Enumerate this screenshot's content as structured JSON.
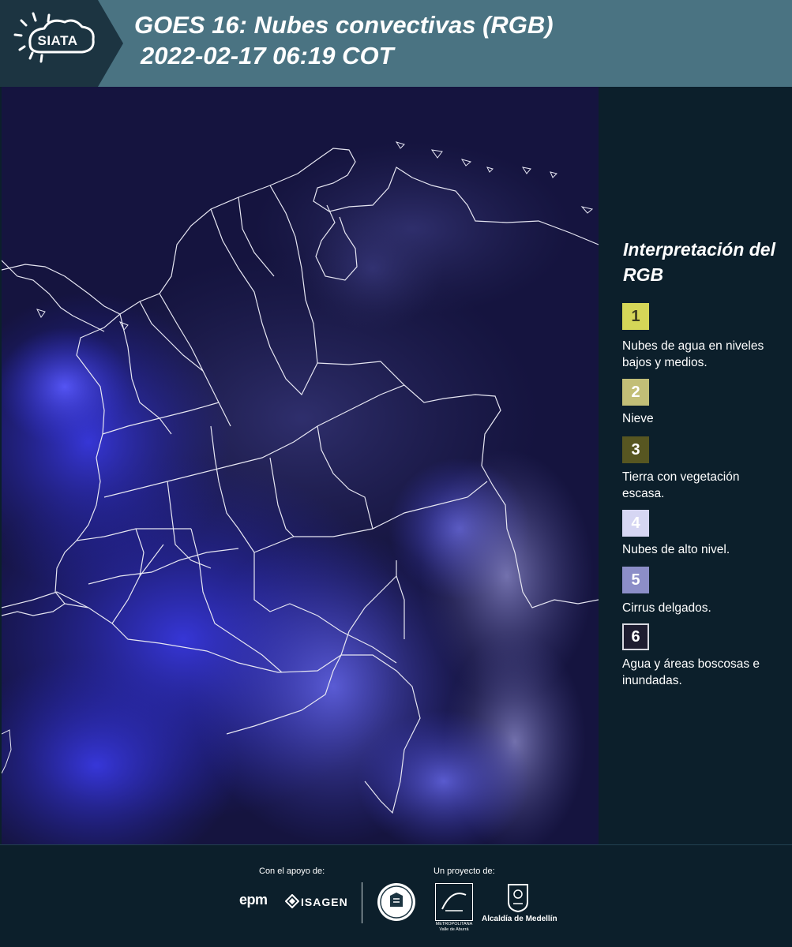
{
  "header": {
    "logo_text": "SIATA",
    "title_line1": "GOES 16: Nubes convectivas (RGB)",
    "title_line2": "2022-02-17 06:19 COT"
  },
  "legend": {
    "title": "Interpretación del RGB",
    "items": [
      {
        "number": "1",
        "label": "Nubes de agua en niveles bajos y medios.",
        "color": "#d5d658",
        "text_color": "#3d3d1f"
      },
      {
        "number": "2",
        "label": "Nieve",
        "color": "#c2be77",
        "text_color": "#ffffff"
      },
      {
        "number": "3",
        "label": "Tierra con vegetación escasa.",
        "color": "#575621",
        "text_color": "#ffffff"
      },
      {
        "number": "4",
        "label": "Nubes de alto nivel.",
        "color": "#d6d6f3",
        "text_color": "#ffffff"
      },
      {
        "number": "5",
        "label": "Cirrus delgados.",
        "color": "#8c8ec8",
        "text_color": "#ffffff"
      },
      {
        "number": "6",
        "label": "Agua y áreas boscosas e inundadas.",
        "color": "#1e1c30",
        "text_color": "#ffffff"
      }
    ]
  },
  "footer": {
    "support_caption": "Con el apoyo de:",
    "project_caption": "Un proyecto de:",
    "sponsor_epm": "epm",
    "sponsor_isagen": "ISAGEN",
    "partner_area": "METROPOLITANA Valle de Aburrá",
    "partner_medellin": "Alcaldía de Medellín"
  },
  "colors": {
    "header_bg": "#4a7382",
    "logo_tab_bg": "#1c3441",
    "page_bg": "#0c1f2b",
    "map_bg": "#15143f",
    "convective_blue": "#3a3af5"
  }
}
